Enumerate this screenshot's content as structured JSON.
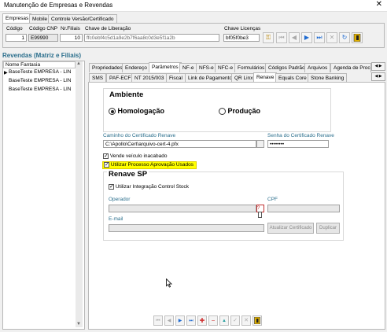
{
  "window": {
    "title": "Manutenção de Empresas e Revendas",
    "close": "✕"
  },
  "top_tabs": [
    "Empresas",
    "Mobile",
    "Controle Versão/Certificado"
  ],
  "form": {
    "codigo_label": "Código",
    "codigo_value": "1",
    "cnp_label": "Código CNP",
    "cnp_value": "E99990",
    "filiais_label": "Nr.Filiais",
    "filiais_value": "10",
    "chave_lib_label": "Chave de Liberação",
    "chave_lib_value": "ffc0ebf4c5d1a9e2b7f6aa8c0d3e5f1a2b",
    "chave_lic_label": "Chave Licenças",
    "chave_lic_value": "bf05f0be3"
  },
  "toolbar_icons": [
    "key-icon",
    "first-icon",
    "prev-icon",
    "next-icon",
    "last-icon",
    "cancel-icon",
    "refresh-icon",
    "exit-icon"
  ],
  "sidebar": {
    "title": "Revendas (Matriz e Filiais)",
    "column": "Nome Fantasia",
    "rows": [
      "BaseTeste EMPRESA - LIN",
      "BaseTeste EMPRESA - LIN",
      "BaseTeste EMPRESA - LIN"
    ]
  },
  "main_tabs_row1": [
    "Propriedades",
    "Endereço",
    "Parâmetros",
    "NF-e",
    "NFS-e",
    "NFC-e",
    "Formulários",
    "Códigos Padrão",
    "Arquivos",
    "Agenda de Proce"
  ],
  "main_tabs_row2": [
    "SMS",
    "PAF-ECF",
    "NT 2015/003",
    "Fiscal",
    "Link de Pagamento",
    "QR Linx",
    "Renave",
    "Equals Core",
    "Stone Banking"
  ],
  "ambiente": {
    "title": "Ambiente",
    "opt1": "Homologação",
    "opt2": "Produção"
  },
  "certificado": {
    "caminho_label": "Caminho do Certificado Renave",
    "caminho_value": "C:\\Apollo\\Cert\\arquivo-cert-4.pfx",
    "senha_label": "Senha do Certificado Renave",
    "senha_value": "••••••••"
  },
  "checks": {
    "vende": "Vende veículo inacabado",
    "utilizar": "Utilizar Processo Aprovação Usados"
  },
  "renave_sp": {
    "title": "Renave SP",
    "integracao": "Utilizar Integração Control Stock",
    "operador_label": "Operador",
    "cpf_label": "CPF",
    "email_label": "E-mail",
    "atualizar": "Atualizar Certificado",
    "duplicar": "Duplicar",
    "help": "?"
  },
  "colors": {
    "section_title": "#2a6e8c",
    "highlight": "#ffff00",
    "operador_label": "#2a6e8c"
  }
}
